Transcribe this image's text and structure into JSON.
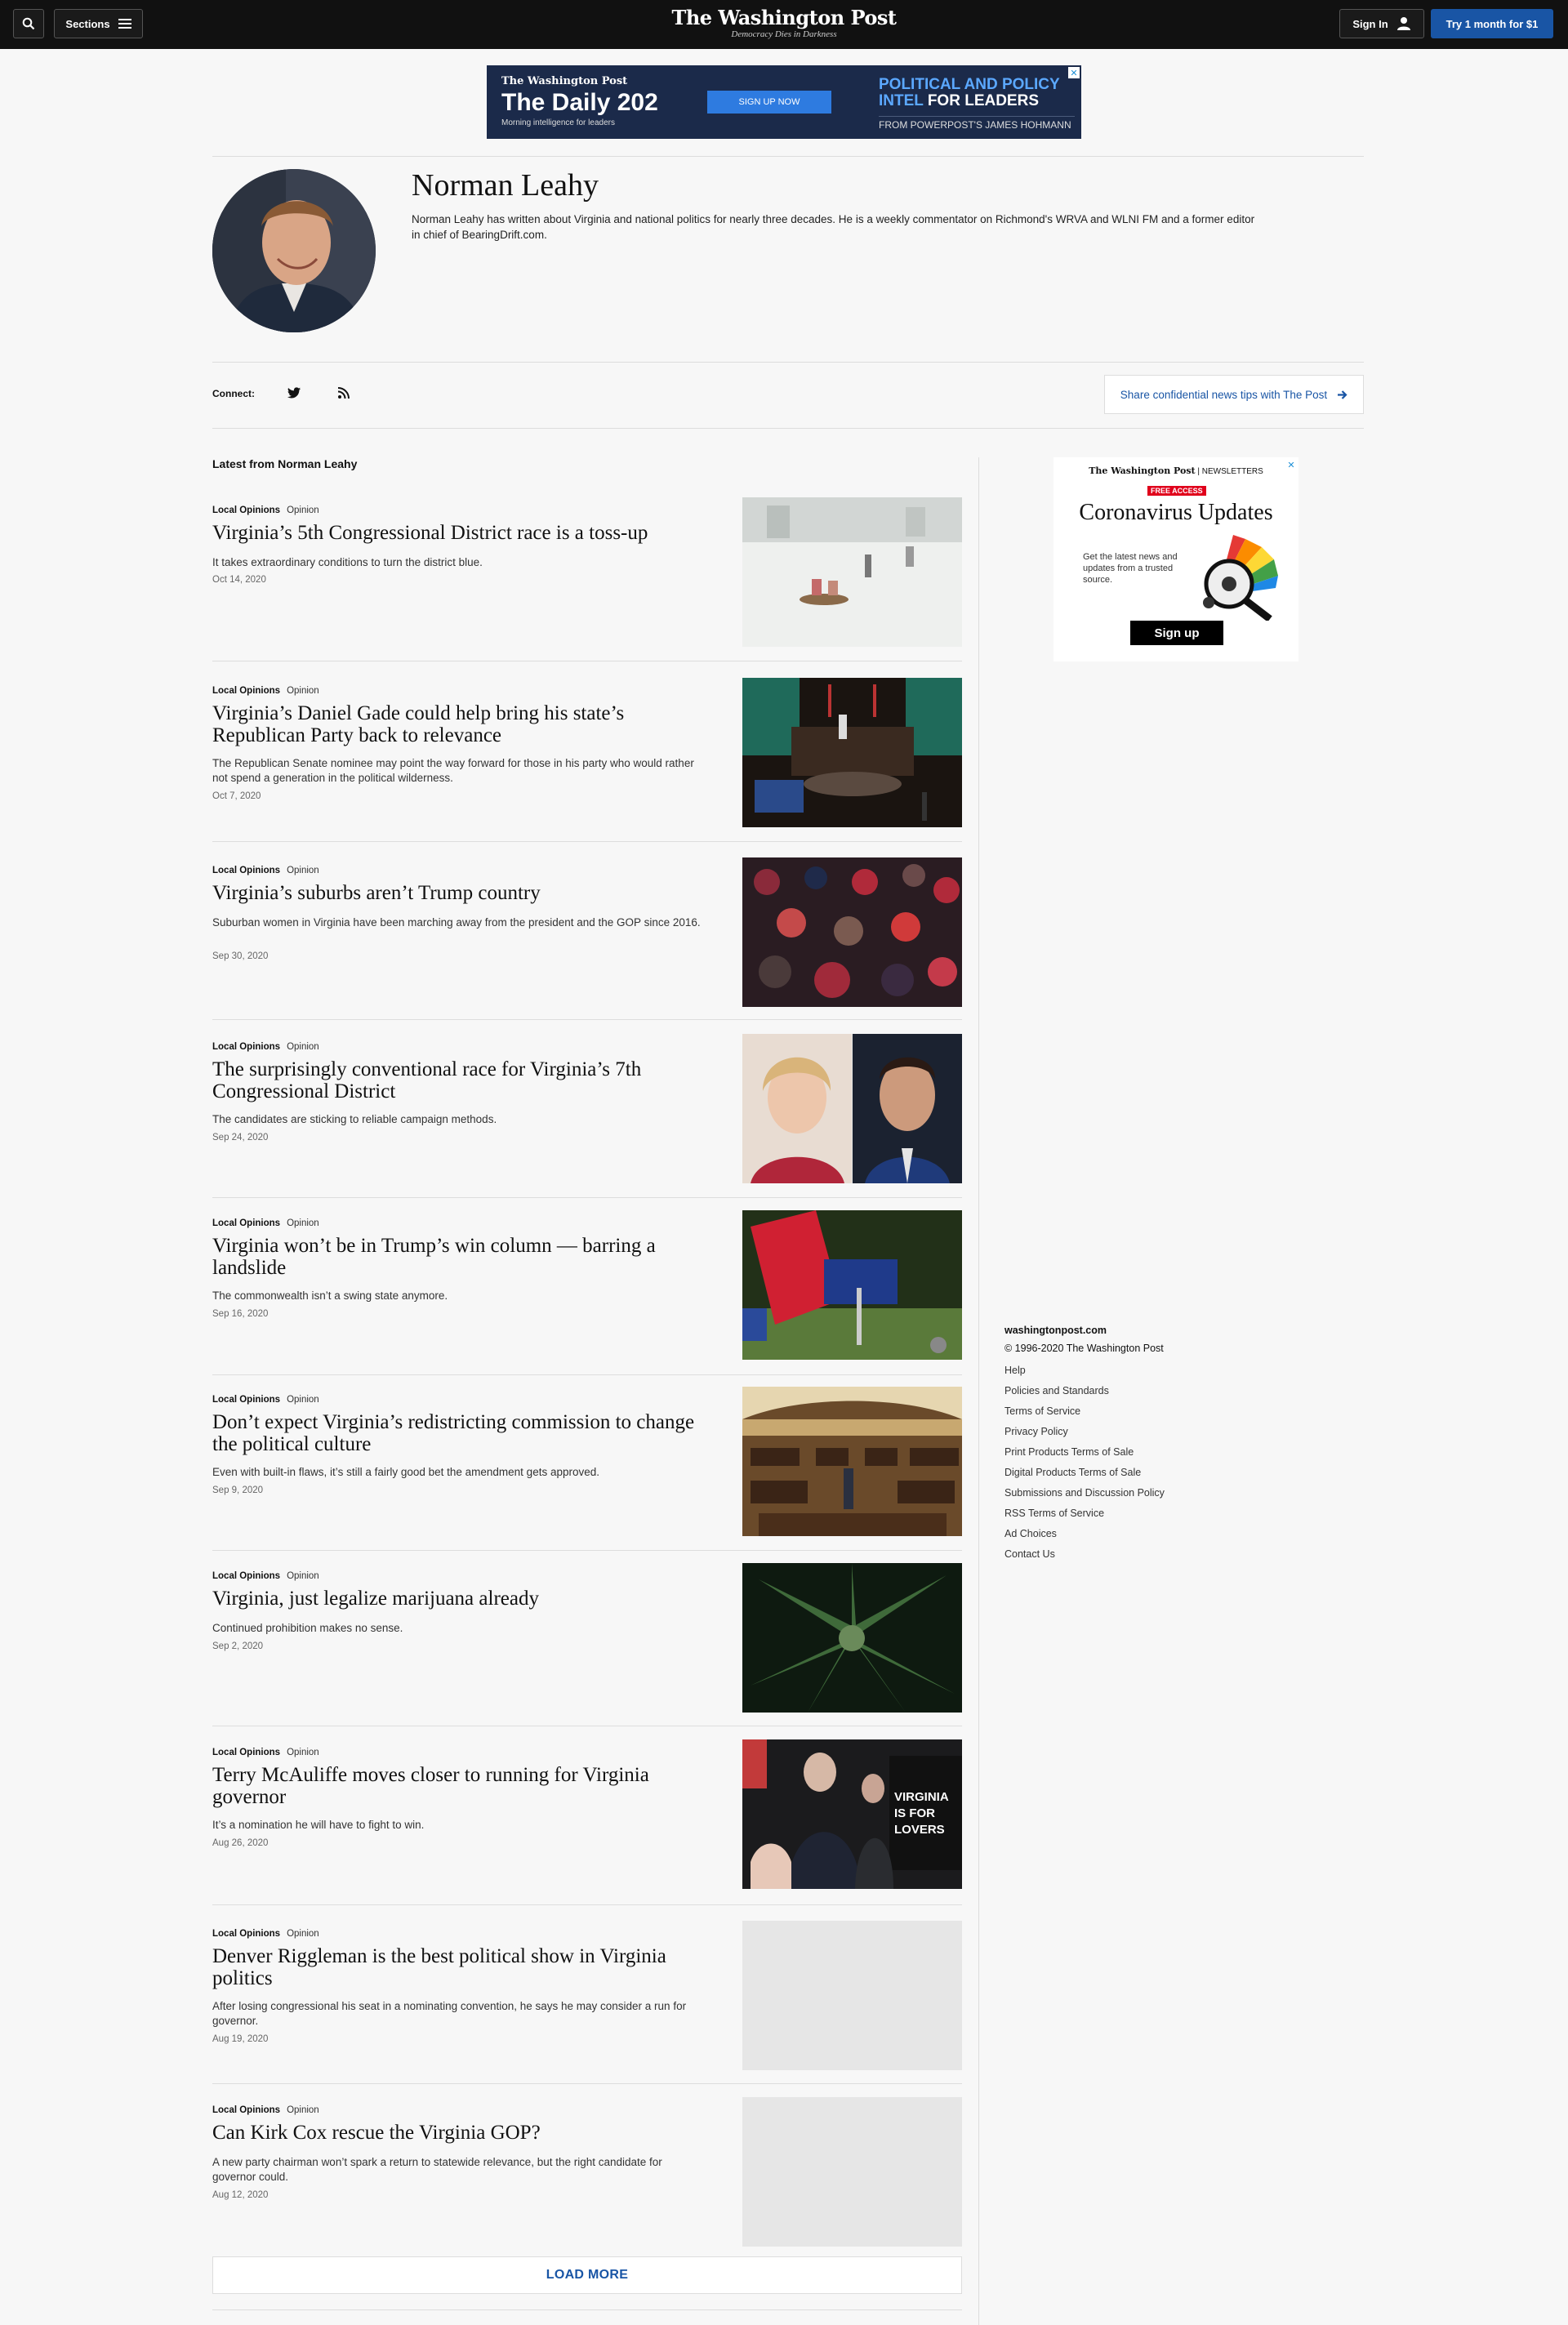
{
  "header": {
    "sections_label": "Sections",
    "logo_name": "The Washington Post",
    "logo_tagline": "Democracy Dies in Darkness",
    "signin_label": "Sign In",
    "try_label": "Try 1 month for $1"
  },
  "top_ad": {
    "brand": "The Washington Post",
    "title": "The Daily 202",
    "subtitle": "Morning intelligence for leaders",
    "cta": "SIGN UP NOW",
    "line1": "POLITICAL AND POLICY",
    "line2a": "INTEL",
    "line2b": " FOR LEADERS",
    "line3": "FROM POWERPOST'S JAMES HOHMANN",
    "close": "✕"
  },
  "author": {
    "name": "Norman Leahy",
    "bio": "Norman Leahy has written about Virginia and national politics for nearly three decades. He is a weekly commentator on Richmond's WRVA and WLNI FM and a former editor in chief of BearingDrift.com."
  },
  "connect": {
    "label": "Connect:",
    "tips_label": "Share confidential news tips with The Post"
  },
  "latest_label": "Latest from Norman Leahy",
  "articles": [
    {
      "section": "Local Opinions",
      "type": "Opinion",
      "headline": "Virginia’s 5th Congressional District race is a toss-up",
      "blurb": "It takes extraordinary conditions to turn the district blue.",
      "date": "Oct 14, 2020"
    },
    {
      "section": "Local Opinions",
      "type": "Opinion",
      "headline": "Virginia’s Daniel Gade could help bring his state’s Republican Party back to relevance",
      "blurb": "The Republican Senate nominee may point the way forward for those in his party who would rather not spend a generation in the political wilderness.",
      "date": "Oct 7, 2020"
    },
    {
      "section": "Local Opinions",
      "type": "Opinion",
      "headline": "Virginia’s suburbs aren’t Trump country",
      "blurb": "Suburban women in Virginia have been marching away from the president and the GOP since 2016.",
      "date": "Sep 30, 2020"
    },
    {
      "section": "Local Opinions",
      "type": "Opinion",
      "headline": "The surprisingly conventional race for Virginia’s 7th Congressional District",
      "blurb": "The candidates are sticking to reliable campaign methods.",
      "date": "Sep 24, 2020"
    },
    {
      "section": "Local Opinions",
      "type": "Opinion",
      "headline": "Virginia won’t be in Trump’s win column — barring a landslide",
      "blurb": "The commonwealth isn’t a swing state anymore.",
      "date": "Sep 16, 2020"
    },
    {
      "section": "Local Opinions",
      "type": "Opinion",
      "headline": "Don’t expect Virginia’s redistricting commission to change the political culture",
      "blurb": "Even with built-in flaws, it’s still a fairly good bet the amendment gets approved.",
      "date": "Sep 9, 2020"
    },
    {
      "section": "Local Opinions",
      "type": "Opinion",
      "headline": "Virginia, just legalize marijuana already",
      "blurb": "Continued prohibition makes no sense.",
      "date": "Sep 2, 2020"
    },
    {
      "section": "Local Opinions",
      "type": "Opinion",
      "headline": "Terry McAuliffe moves closer to running for Virginia governor",
      "blurb": "It’s a nomination he will have to fight to win.",
      "date": "Aug 26, 2020"
    },
    {
      "section": "Local Opinions",
      "type": "Opinion",
      "headline": "Denver Riggleman is the best political show in Virginia politics",
      "blurb": "After losing congressional his seat in a nominating convention, he says he may consider a run for governor.",
      "date": "Aug 19, 2020"
    },
    {
      "section": "Local Opinions",
      "type": "Opinion",
      "headline": "Can Kirk Cox rescue the Virginia GOP?",
      "blurb": "A new party chairman won’t spark a return to statewide relevance, but the right candidate for governor could.",
      "date": "Aug 12, 2020"
    }
  ],
  "load_more": "LOAD MORE",
  "side_ad": {
    "brand": "The Washington Post",
    "brand_suffix": " | NEWSLETTERS",
    "badge": "FREE ACCESS",
    "headline": "Coronavirus Updates",
    "text": "Get the latest news and updates from a trusted source.",
    "cta": "Sign up",
    "close": "✕"
  },
  "footer": {
    "site": "washingtonpost.com",
    "copyright": "© 1996-2020 The Washington Post",
    "links": [
      "Help",
      "Policies and Standards",
      "Terms of Service",
      "Privacy Policy",
      "Print Products Terms of Sale",
      "Digital Products Terms of Sale",
      "Submissions and Discussion Policy",
      "RSS Terms of Service",
      "Ad Choices",
      "Contact Us"
    ]
  },
  "colors": {
    "accent": "#1955a5",
    "topbar": "#111111",
    "background": "#f7f7f7"
  }
}
